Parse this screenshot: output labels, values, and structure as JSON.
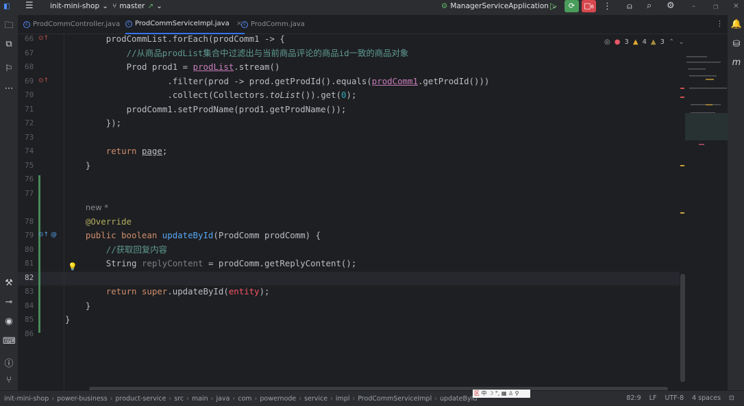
{
  "titlebar": {
    "project": "init-mini-shop",
    "branch": "master",
    "run_config": "ManagerServiceApplication",
    "debug_badge": "6"
  },
  "tabs": [
    {
      "label": "ProdCommController.java",
      "active": false
    },
    {
      "label": "ProdCommServiceImpl.java",
      "active": true
    },
    {
      "label": "ProdComm.java",
      "active": false
    }
  ],
  "inspections": {
    "errors": "3",
    "warnings": "4",
    "weak_warnings": "3"
  },
  "editor": {
    "current_line": "82",
    "lines": [
      {
        "num": "66",
        "indent": 8,
        "tokens": [
          [
            "prodCommList.forEach(prodComm1 -> {",
            ""
          ]
        ]
      },
      {
        "num": "67",
        "indent": 12,
        "tokens": [
          [
            "//从商品prodList集合中过滤出与当前商品评论的商品id一致的商品对象",
            "c"
          ]
        ]
      },
      {
        "num": "68",
        "indent": 12,
        "tokens": [
          [
            "Prod prod1 = ",
            ""
          ],
          [
            "prodList",
            "f"
          ],
          [
            ".stream()",
            ""
          ]
        ]
      },
      {
        "num": "69",
        "indent": 20,
        "tokens": [
          [
            ".filter(prod -> prod.getProdId().equals(",
            ""
          ],
          [
            "prodComm1",
            "fu"
          ],
          [
            ".getProdId()))",
            ""
          ]
        ]
      },
      {
        "num": "70",
        "indent": 20,
        "tokens": [
          [
            ".collect(Collectors.",
            ""
          ],
          [
            "toList",
            "i"
          ],
          [
            "()).get(",
            ""
          ],
          [
            "0",
            "n"
          ],
          [
            ");",
            ""
          ]
        ]
      },
      {
        "num": "71",
        "indent": 12,
        "tokens": [
          [
            "prodComm1.setProdName(prod1.getProdName());",
            ""
          ]
        ]
      },
      {
        "num": "72",
        "indent": 8,
        "tokens": [
          [
            "});",
            ""
          ]
        ]
      },
      {
        "num": "73",
        "indent": 0,
        "tokens": []
      },
      {
        "num": "74",
        "indent": 8,
        "tokens": [
          [
            "return ",
            "k"
          ],
          [
            "page",
            "u"
          ],
          [
            ";",
            ""
          ]
        ]
      },
      {
        "num": "75",
        "indent": 4,
        "tokens": [
          [
            "}",
            ""
          ]
        ]
      },
      {
        "num": "76",
        "indent": 0,
        "tokens": []
      },
      {
        "num": "77",
        "indent": 0,
        "tokens": []
      },
      {
        "num": "",
        "indent": 4,
        "tokens": [
          [
            "new *",
            "hint"
          ]
        ]
      },
      {
        "num": "78",
        "indent": 4,
        "tokens": [
          [
            "@Override",
            "a"
          ]
        ]
      },
      {
        "num": "79",
        "indent": 4,
        "tokens": [
          [
            "public boolean ",
            "k"
          ],
          [
            "updateById",
            "m"
          ],
          [
            "(ProdComm prodComm) {",
            ""
          ]
        ]
      },
      {
        "num": "80",
        "indent": 8,
        "tokens": [
          [
            "//获取回复内容",
            "c"
          ]
        ]
      },
      {
        "num": "81",
        "indent": 8,
        "tokens": [
          [
            "String ",
            ""
          ],
          [
            "replyContent",
            "g"
          ],
          [
            " = prodComm.getReplyContent();",
            ""
          ]
        ]
      },
      {
        "num": "82",
        "indent": 0,
        "tokens": []
      },
      {
        "num": "83",
        "indent": 8,
        "tokens": [
          [
            "return ",
            "k"
          ],
          [
            "super",
            "k"
          ],
          [
            ".updateById(",
            ""
          ],
          [
            "entity",
            "e"
          ],
          [
            ");",
            ""
          ]
        ]
      },
      {
        "num": "84",
        "indent": 4,
        "tokens": [
          [
            "}",
            ""
          ]
        ]
      },
      {
        "num": "85",
        "indent": 0,
        "tokens": [
          [
            "}",
            ""
          ]
        ]
      },
      {
        "num": "86",
        "indent": 0,
        "tokens": []
      }
    ]
  },
  "breadcrumb": [
    "init-mini-shop",
    "power-business",
    "product-service",
    "src",
    "main",
    "java",
    "com",
    "powernode",
    "service",
    "impl",
    "ProdCommServiceImpl",
    "updateById"
  ],
  "status": {
    "position": "82:9",
    "line_sep": "LF",
    "encoding": "UTF-8",
    "indent": "4 spaces"
  },
  "ime_bar": "中 ☽ °, ▦ ♙ ⚲",
  "colors": {
    "accent": "#3574f0",
    "keyword": "#cf8e6d",
    "method": "#56a8f5",
    "comment": "#5f9a92",
    "annotation": "#b3ae60",
    "error": "#f75464"
  }
}
